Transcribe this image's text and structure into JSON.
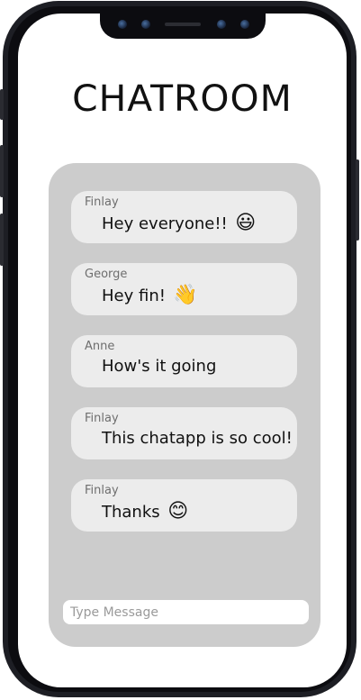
{
  "app": {
    "title": "CHATROOM"
  },
  "messages": [
    {
      "sender": "Finlay",
      "text": "Hey everyone!!",
      "emoji": "😃"
    },
    {
      "sender": "George",
      "text": "Hey fin!",
      "emoji": "👋"
    },
    {
      "sender": "Anne",
      "text": "How's it going",
      "emoji": ""
    },
    {
      "sender": "Finlay",
      "text": "This chatapp is so cool!",
      "emoji": ""
    },
    {
      "sender": "Finlay",
      "text": "Thanks",
      "emoji": "😊"
    }
  ],
  "composer": {
    "placeholder": "Type Message",
    "value": ""
  },
  "colors": {
    "phone_frame": "#1d1e24",
    "panel": "#cccccc",
    "bubble": "#ececec",
    "sender_text": "#6e6e6e"
  }
}
